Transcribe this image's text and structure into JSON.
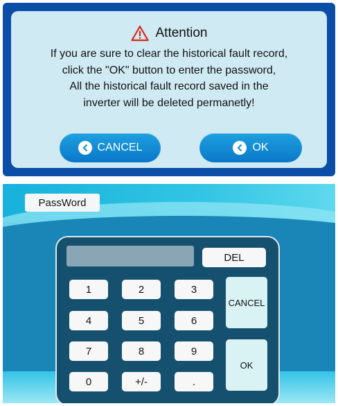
{
  "dialog": {
    "title": "Attention",
    "message_lines": [
      "If you are sure to clear the historical fault record,",
      "click the \"OK\" button to enter the password,",
      "All the historical fault record saved in the",
      "inverter will be deleted permanetly!"
    ],
    "cancel_label": "CANCEL",
    "ok_label": "OK",
    "warning_icon": "warning-triangle-icon",
    "button_icon": "chevron-left-circle-icon",
    "colors": {
      "frame": "#0b4ea8",
      "panel": "#cfeaf3",
      "button": "#1593d6",
      "warning": "#d9261c"
    }
  },
  "keypad": {
    "tab_label": "PassWord",
    "display_value": "",
    "del_label": "DEL",
    "cancel_label": "CANCEL",
    "ok_label": "OK",
    "keys": [
      [
        "1",
        "2",
        "3"
      ],
      [
        "4",
        "5",
        "6"
      ],
      [
        "7",
        "8",
        "9"
      ],
      [
        "0",
        "+/-",
        "."
      ]
    ],
    "colors": {
      "background": "#1a86b8",
      "pad": "#15506e",
      "key": "#f7f7f7",
      "side_key": "#d9f3f5"
    }
  }
}
